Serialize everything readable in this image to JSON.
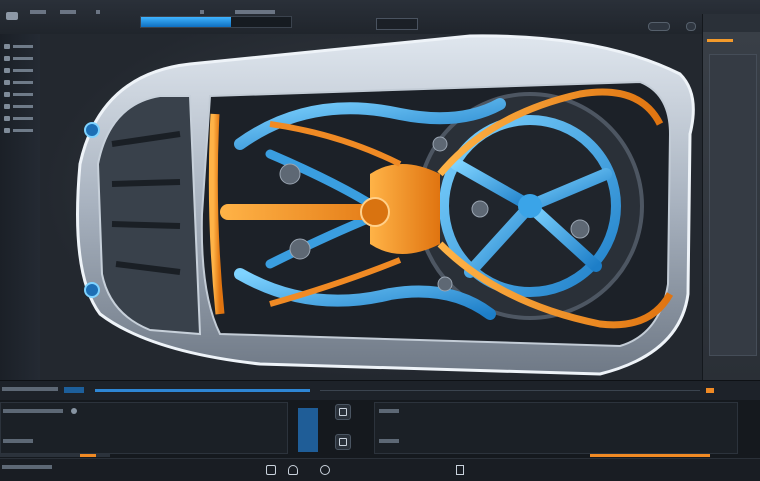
{
  "window": {
    "title": ""
  },
  "toolbar": {
    "items": [
      "",
      "",
      "",
      "",
      ""
    ],
    "progress": 0.6
  },
  "sidebar": {
    "items": [
      "",
      "",
      "",
      "",
      "",
      "",
      "",
      ""
    ]
  },
  "viewport": {
    "subject": "car-chassis-render"
  },
  "bottom": {
    "left_rows": [
      "",
      ""
    ],
    "right_rows": [
      "",
      ""
    ]
  },
  "colors": {
    "accent_blue": "#2e86d4",
    "accent_orange": "#f08a24",
    "panel_bg": "#1b2026"
  }
}
